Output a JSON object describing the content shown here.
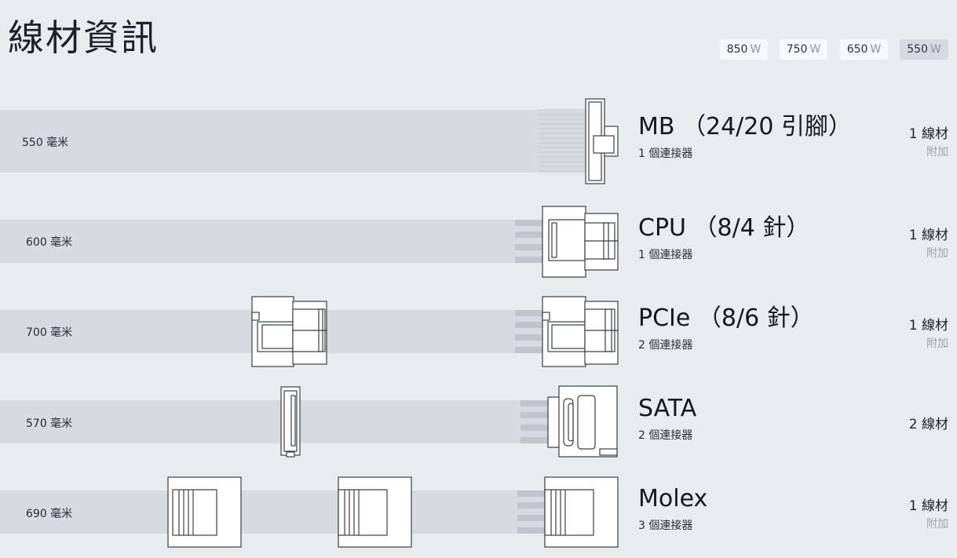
{
  "title": "線材資訊",
  "wattage": {
    "unit": "W",
    "options": [
      "850",
      "750",
      "650",
      "550"
    ],
    "selected": "550"
  },
  "cables": [
    {
      "length": "550 毫米",
      "name": "MB （24/20 引腳）",
      "connectors": "1 個連接器",
      "quantity": "1 線材",
      "tag": "附加"
    },
    {
      "length": "600 毫米",
      "name": "CPU （8/4 針）",
      "connectors": "1 個連接器",
      "quantity": "1 線材",
      "tag": "附加"
    },
    {
      "length": "700 毫米",
      "name": "PCIe （8/6 針）",
      "connectors": "2 個連接器",
      "quantity": "1 線材",
      "tag": "附加"
    },
    {
      "length": "570 毫米",
      "name": "SATA",
      "connectors": "2 個連接器",
      "quantity": "2 線材",
      "tag": ""
    },
    {
      "length": "690 毫米",
      "name": "Molex",
      "connectors": "3 個連接器",
      "quantity": "1 線材",
      "tag": "附加"
    }
  ]
}
